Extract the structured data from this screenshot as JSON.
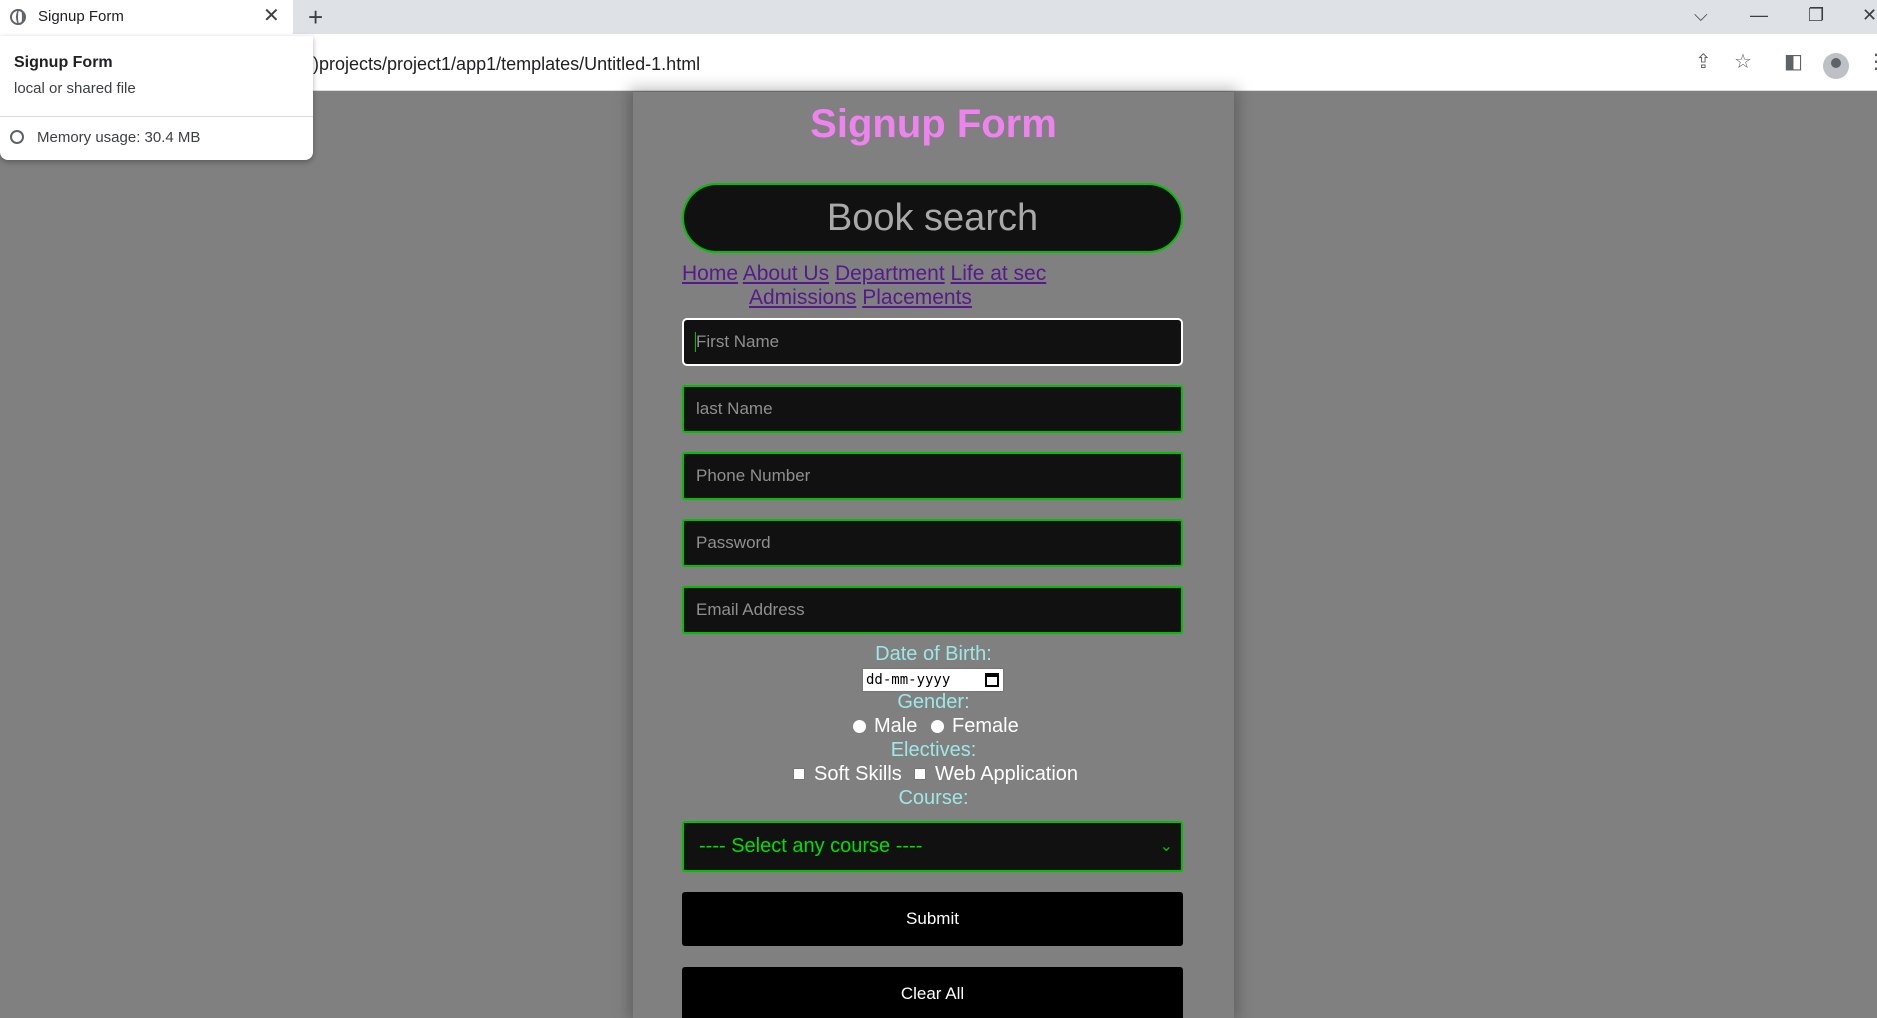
{
  "browser": {
    "tab_title": "Signup Form",
    "tab_close": "✕",
    "new_tab": "+",
    "url": ")projects/project1/app1/templates/Untitled-1.html",
    "window_controls": {
      "tab_search": "⌵",
      "minimize": "—",
      "restore": "❐",
      "close": "✕"
    },
    "toolbar_icons": {
      "share": "⇪",
      "star": "☆",
      "side_panel": "◧",
      "menu": "⋮"
    }
  },
  "hover_card": {
    "title": "Signup Form",
    "subtitle": "local or shared file",
    "memory": "Memory usage: 30.4 MB"
  },
  "form": {
    "title": "Signup Form",
    "search_placeholder": "Book search",
    "nav_links": [
      "Home",
      "About Us",
      "Department",
      "Life at sec",
      "Admissions",
      "Placements"
    ],
    "fields": {
      "first_name": "First Name",
      "last_name": "last Name",
      "phone": "Phone Number",
      "password": "Password",
      "email": "Email Address"
    },
    "dob_label": "Date of Birth:",
    "dob_value": "dd-mm-yyyy",
    "gender_label": "Gender:",
    "gender_options": [
      "Male",
      "Female"
    ],
    "electives_label": "Electives:",
    "electives_options": [
      "Soft Skills",
      "Web Application"
    ],
    "course_label": "Course:",
    "course_select": "---- Select any course ----",
    "submit_label": "Submit",
    "clear_label": "Clear All"
  },
  "colors": {
    "title": "#ee82ee",
    "field_border": "#00c000",
    "label": "#9fe6e6",
    "background": "#808080"
  }
}
